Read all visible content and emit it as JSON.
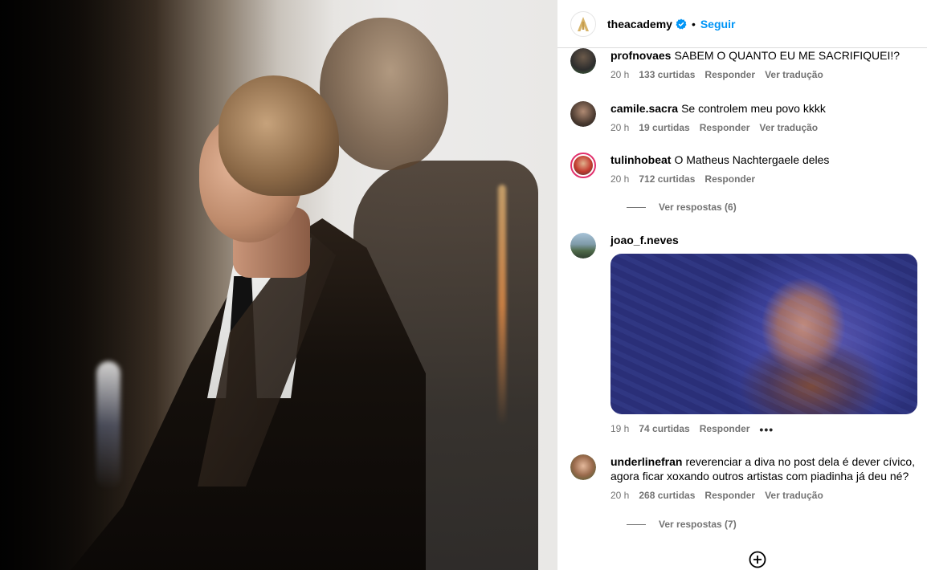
{
  "header": {
    "username": "theacademy",
    "separator": "•",
    "follow_label": "Seguir",
    "logo_icon": "academy-oscar-logo",
    "verified_icon": "verified-badge-icon"
  },
  "comments": [
    {
      "username": "profnovaes",
      "text": "SABEM O QUANTO EU ME SACRIFIQUEI!?",
      "time": "20 h",
      "likes": "133 curtidas",
      "reply": "Responder",
      "translate": "Ver tradução"
    },
    {
      "username": "camile.sacra",
      "text": "Se controlem meu povo kkkk",
      "time": "20 h",
      "likes": "19 curtidas",
      "reply": "Responder",
      "translate": "Ver tradução"
    },
    {
      "username": "tulinhobeat",
      "text": "O Matheus Nachtergaele deles",
      "time": "20 h",
      "likes": "712 curtidas",
      "reply": "Responder",
      "view_replies": "Ver respostas (6)"
    },
    {
      "username": "joao_f.neves",
      "text": "",
      "time": "19 h",
      "likes": "74 curtidas",
      "reply": "Responder",
      "more": "•••"
    },
    {
      "username": "underlinefran",
      "text": "reverenciar a diva no post dela é dever cívico, agora ficar xoxando outros artistas com piadinha já deu né?",
      "time": "20 h",
      "likes": "268 curtidas",
      "reply": "Responder",
      "translate": "Ver tradução",
      "view_replies": "Ver respostas (7)"
    }
  ],
  "colors": {
    "accent": "#0095f6",
    "muted": "#737373",
    "story_ring": "#e1306c"
  }
}
